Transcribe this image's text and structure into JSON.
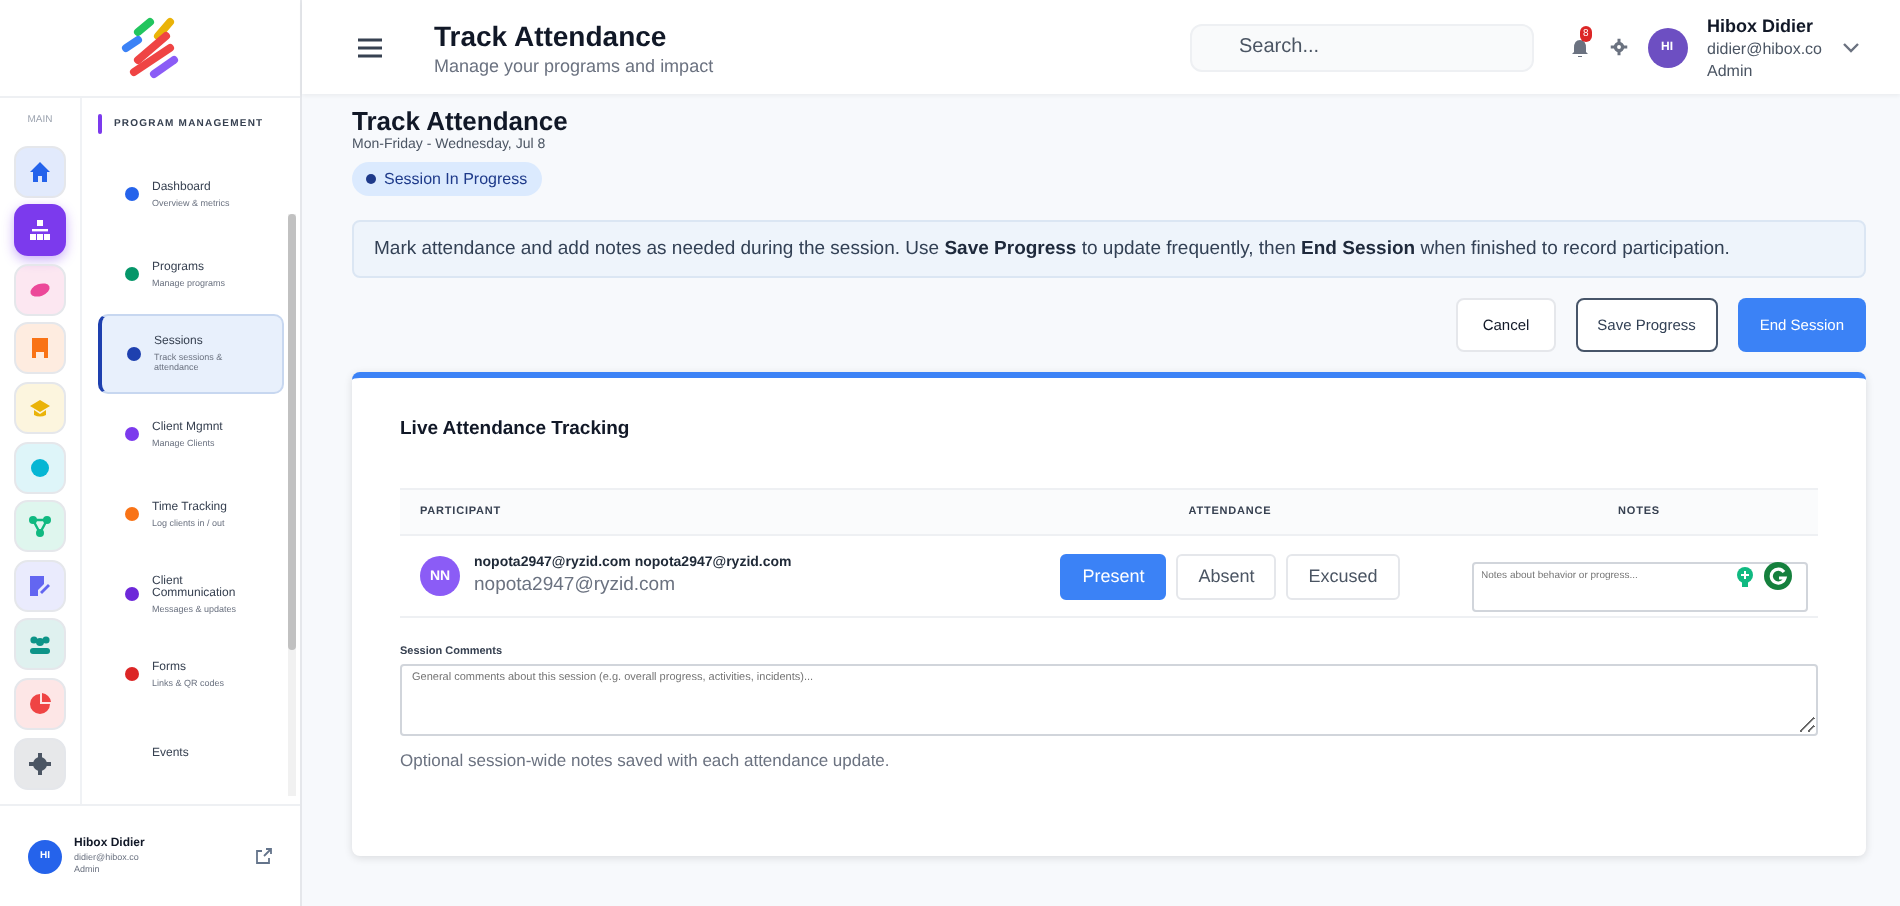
{
  "sidebar": {
    "rail_label": "MAIN",
    "rail": [
      {
        "selected": false,
        "color": "#2563eb"
      },
      {
        "selected": true,
        "color": "#7c3aed"
      },
      {
        "selected": false,
        "color": "#ec4899"
      },
      {
        "selected": false,
        "color": "#f97316"
      },
      {
        "selected": false,
        "color": "#eab308"
      },
      {
        "selected": false,
        "color": "#06b6d4"
      },
      {
        "selected": false,
        "color": "#10b981"
      },
      {
        "selected": false,
        "color": "#6366f1"
      },
      {
        "selected": false,
        "color": "#0d9488"
      },
      {
        "selected": false,
        "color": "#ef4444"
      },
      {
        "selected": false,
        "color": "#4b5563"
      }
    ],
    "nav_heading": "PROGRAM MANAGEMENT",
    "nav_items": [
      {
        "title": "Dashboard",
        "subtitle": "Overview & metrics",
        "selected": false,
        "color": "#2563eb"
      },
      {
        "title": "Programs",
        "subtitle": "Manage programs",
        "selected": false,
        "color": "#059669"
      },
      {
        "title": "Sessions",
        "subtitle": "Track sessions & attendance",
        "selected": true,
        "color": "#1e40af"
      },
      {
        "title": "Client Mgmnt",
        "subtitle": "Manage Clients",
        "selected": false,
        "color": "#7c3aed"
      },
      {
        "title": "Time Tracking",
        "subtitle": "Log clients in / out",
        "selected": false,
        "color": "#f97316"
      },
      {
        "title": "Client Communication",
        "subtitle": "Messages & updates",
        "selected": false,
        "color": "#6d28d9"
      },
      {
        "title": "Forms",
        "subtitle": "Links & QR codes",
        "selected": false,
        "color": "#dc2626"
      },
      {
        "title": "Events",
        "selected": false
      }
    ],
    "user": {
      "initials": "HI",
      "name": "Hibox Didier",
      "email": "didier@hibox.co",
      "role": "Admin"
    }
  },
  "header": {
    "title": "Track Attendance",
    "subtitle": "Manage your programs and impact",
    "search": {
      "placeholder": "Search..."
    },
    "notification_count": "8",
    "user": {
      "initials": "HI",
      "name": "Hibox Didier",
      "email": "didier@hibox.co",
      "role": "Admin"
    }
  },
  "page": {
    "title": "Track Attendance",
    "schedule": "Mon-Friday - Wednesday, Jul 8",
    "status": "Session In Progress",
    "info": "Mark attendance and add notes as needed during the session. Use **Save Progress** to update frequently, then **End Session** when finished to record participation.",
    "buttons": [
      {
        "label": "Cancel",
        "kind": "plain"
      },
      {
        "label": "Save Progress",
        "kind": "outline"
      },
      {
        "label": "End Session",
        "kind": "primary"
      }
    ],
    "card": {
      "title": "Live Attendance Tracking",
      "columns": [
        "PARTICIPANT",
        "ATTENDANCE",
        "NOTES"
      ],
      "rows": [
        {
          "initials": "NN",
          "name": "nopota2947@ryzid.com nopota2947@ryzid.com",
          "email": "nopota2947@ryzid.com",
          "attendance": [
            {
              "label": "Present",
              "selected": true
            },
            {
              "label": "Absent",
              "selected": false
            },
            {
              "label": "Excused",
              "selected": false
            }
          ],
          "notes": {
            "placeholder": "Notes about behavior or progress..."
          }
        }
      ],
      "comments": {
        "label": "Session Comments",
        "placeholder": "General comments about this session (e.g. overall progress, activities, incidents)...",
        "hint": "Optional session-wide notes saved with each attendance update."
      }
    }
  }
}
